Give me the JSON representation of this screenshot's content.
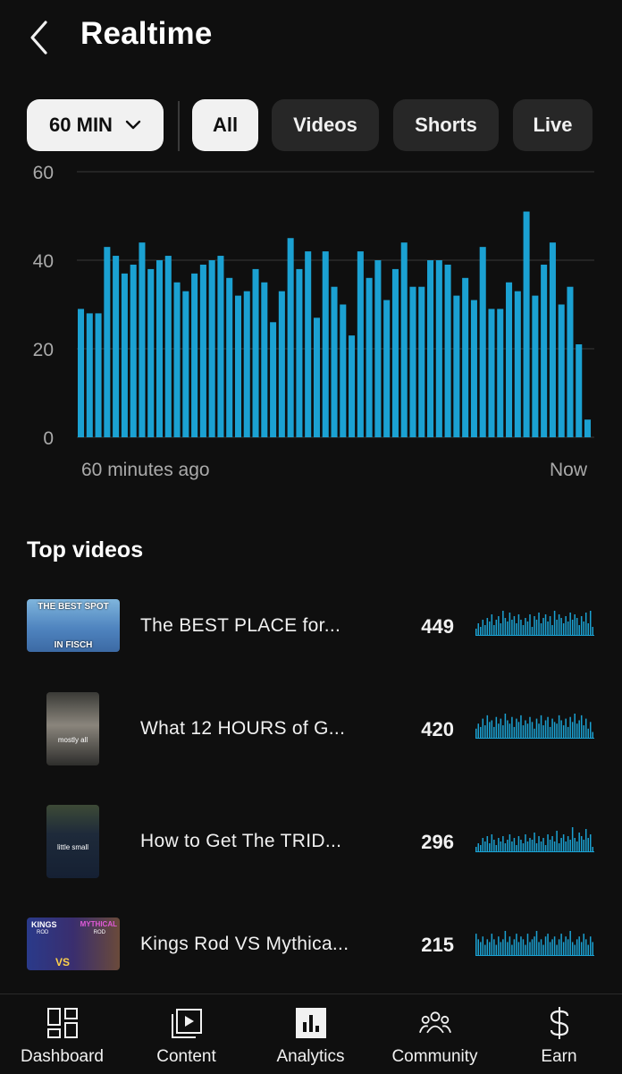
{
  "header": {
    "title": "Realtime",
    "back_icon": "chevron-left-icon"
  },
  "filters": {
    "time_range": "60 MIN",
    "chips": [
      "All",
      "Videos",
      "Shorts",
      "Live"
    ],
    "selected": "All"
  },
  "chart_data": {
    "type": "bar",
    "color": "#1ba1d2",
    "ylim": [
      0,
      60
    ],
    "y_ticks": [
      "0",
      "20",
      "40",
      "60"
    ],
    "x_labels": {
      "start": "60 minutes ago",
      "end": "Now"
    },
    "values": [
      29,
      28,
      28,
      43,
      41,
      37,
      39,
      44,
      38,
      40,
      41,
      35,
      33,
      37,
      39,
      40,
      41,
      36,
      32,
      33,
      38,
      35,
      26,
      33,
      45,
      38,
      42,
      27,
      42,
      34,
      30,
      23,
      42,
      36,
      40,
      31,
      38,
      44,
      34,
      34,
      40,
      40,
      39,
      32,
      36,
      31,
      43,
      29,
      29,
      35,
      33,
      51,
      32,
      39,
      44,
      30,
      34,
      21,
      4
    ]
  },
  "top_videos": {
    "title": "Top videos",
    "items": [
      {
        "title": "The BEST PLACE for...",
        "views": "449",
        "thumb_lines": [
          "THE BEST SPOT",
          "IN FISCH"
        ],
        "spark": [
          4,
          7,
          5,
          9,
          6,
          10,
          8,
          12,
          6,
          9,
          11,
          7,
          14,
          10,
          8,
          13,
          9,
          11,
          7,
          12,
          9,
          6,
          10,
          8,
          12,
          5,
          11,
          9,
          13,
          7,
          10,
          12,
          8,
          11,
          6,
          14,
          9,
          12,
          10,
          7,
          11,
          8,
          13,
          9,
          12,
          10,
          6,
          11,
          8,
          13,
          7,
          14,
          5
        ]
      },
      {
        "title": "What 12 HOURS of G...",
        "views": "420",
        "thumb_lines": [
          "mostly all"
        ],
        "spark": [
          6,
          9,
          7,
          12,
          8,
          14,
          10,
          11,
          7,
          13,
          9,
          12,
          8,
          15,
          11,
          9,
          13,
          7,
          12,
          10,
          14,
          8,
          11,
          9,
          13,
          10,
          6,
          12,
          9,
          14,
          8,
          11,
          13,
          7,
          12,
          10,
          9,
          14,
          11,
          8,
          12,
          7,
          13,
          10,
          15,
          9,
          11,
          14,
          8,
          12,
          6,
          10,
          4
        ]
      },
      {
        "title": "How to Get The TRID...",
        "views": "296",
        "thumb_lines": [
          "little small"
        ],
        "spark": [
          3,
          5,
          4,
          8,
          6,
          9,
          5,
          10,
          7,
          4,
          8,
          6,
          9,
          5,
          7,
          10,
          6,
          8,
          4,
          9,
          7,
          5,
          10,
          6,
          8,
          7,
          11,
          5,
          9,
          6,
          8,
          4,
          10,
          7,
          9,
          6,
          12,
          5,
          8,
          10,
          6,
          9,
          7,
          14,
          8,
          6,
          11,
          9,
          7,
          13,
          8,
          10,
          3
        ]
      },
      {
        "title": "Kings Rod VS Mythica...",
        "views": "215",
        "thumb_lines": [
          "KINGS",
          "ROD",
          "VS",
          "MYTHICAL",
          "ROD"
        ],
        "spark": [
          8,
          6,
          5,
          7,
          4,
          6,
          5,
          8,
          6,
          4,
          7,
          5,
          6,
          9,
          5,
          7,
          4,
          6,
          8,
          5,
          7,
          6,
          4,
          8,
          5,
          6,
          7,
          9,
          5,
          6,
          4,
          7,
          8,
          5,
          6,
          7,
          4,
          6,
          8,
          5,
          7,
          6,
          9,
          5,
          4,
          6,
          7,
          5,
          8,
          6,
          4,
          7,
          5
        ]
      }
    ]
  },
  "bottom_nav": {
    "items": [
      {
        "label": "Dashboard",
        "icon": "dashboard-icon"
      },
      {
        "label": "Content",
        "icon": "content-icon"
      },
      {
        "label": "Analytics",
        "icon": "analytics-icon"
      },
      {
        "label": "Community",
        "icon": "community-icon"
      },
      {
        "label": "Earn",
        "icon": "earn-icon"
      }
    ],
    "active": "Analytics"
  }
}
